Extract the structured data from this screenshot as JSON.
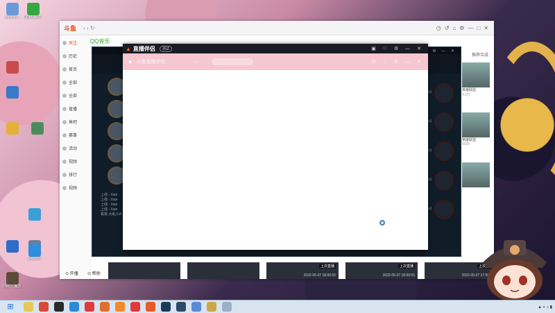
{
  "desktop": {
    "icons": [
      {
        "label": "Adminis...",
        "color": "#6a9bd8"
      },
      {
        "label": "QQMusicS...",
        "color": "#35a742"
      },
      {
        "label": "",
        "color": "#c94b4b"
      },
      {
        "label": "",
        "color": "#3a78c9"
      },
      {
        "label": "",
        "color": "#e5b13a"
      },
      {
        "label": "",
        "color": "#4d8b5e"
      },
      {
        "label": "",
        "color": "#3aa0d8"
      },
      {
        "label": "",
        "color": "#2f6bc8"
      },
      {
        "label": "",
        "color": "#6a7f9a"
      },
      {
        "label": "Explorer",
        "color": "#2f8de0"
      },
      {
        "label": "DMC：魔法 3DM最新",
        "color": "#5b4b3a"
      }
    ]
  },
  "browser": {
    "tab_label": "",
    "qqmusic_label": "QQ音乐",
    "followers_text": "推荐合成",
    "left_nav": [
      "关注",
      "历史",
      "首页",
      "全部",
      "全部",
      "直播",
      "鱼吧",
      "赛事",
      "活动",
      "视频",
      "排行",
      "视频"
    ],
    "footer_open": "开播",
    "footer_help": "帮助",
    "side_cards": [
      {
        "name": "英雄联盟",
        "count": "4.2万"
      },
      {
        "name": "英雄联盟",
        "count": "4025"
      },
      {
        "name": "",
        "count": ""
      }
    ],
    "bottom_thumbs": [
      {
        "label": "",
        "date": ""
      },
      {
        "label": "",
        "date": ""
      },
      {
        "label": "上次直播",
        "date": "2022-05-07 18:00:55"
      },
      {
        "label": "上次直播",
        "date": "2022-05-07 18:00:55"
      },
      {
        "label": "上次直播",
        "date": "2022-05-07 17:59:55"
      }
    ]
  },
  "game": {
    "chat": [
      "上线 - Xian",
      "上线 - Xian",
      "上线 - Xian",
      "上线 - Xian",
      "看看·大乱斗A"
    ],
    "right_levels": [
      "lv1",
      "lv1",
      "lv1",
      "lv1",
      "lv1"
    ]
  },
  "zhibo": {
    "brand": "直播伴侣",
    "version": "测试",
    "title": "斗鱼直播伴侣"
  }
}
